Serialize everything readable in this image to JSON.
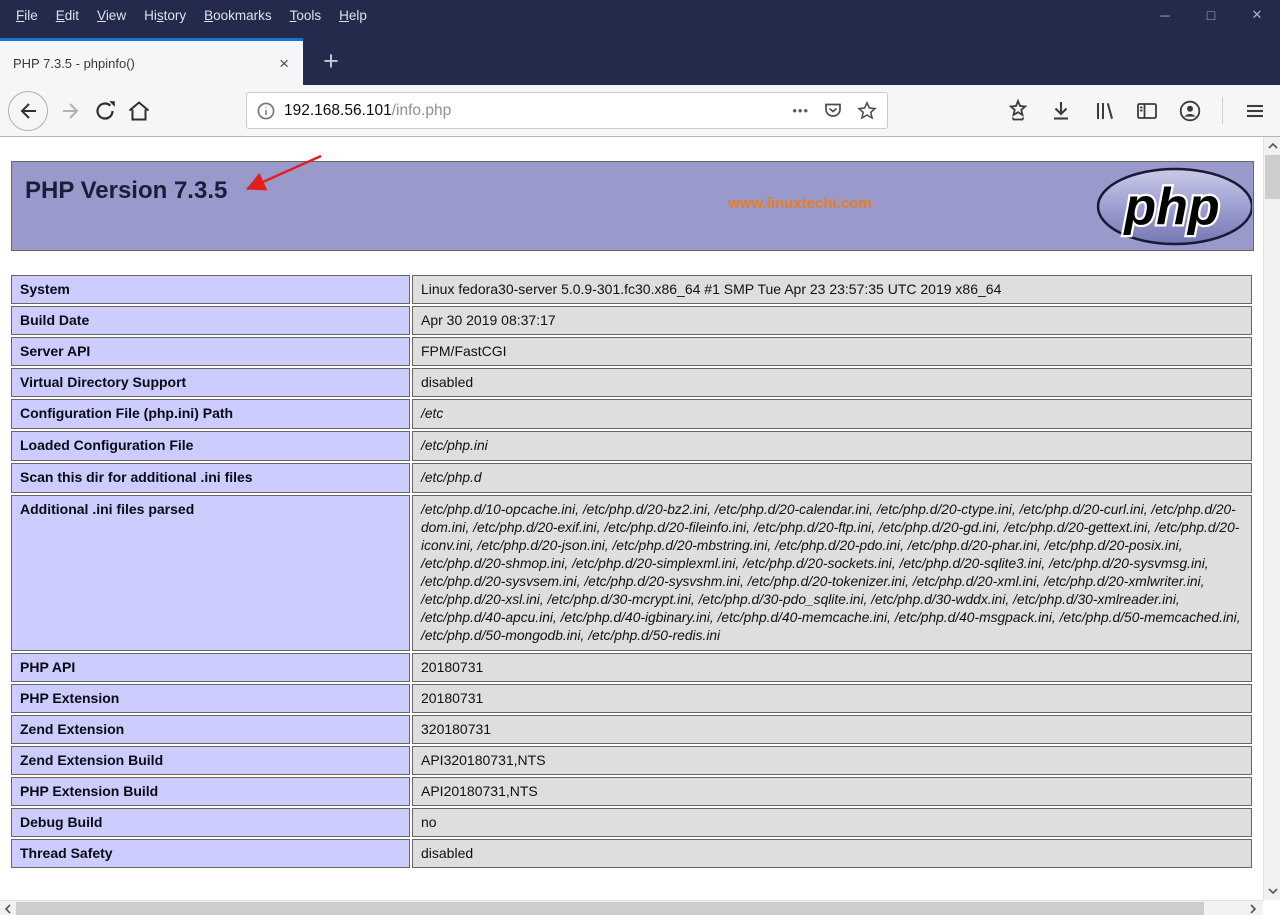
{
  "browser": {
    "menu": [
      {
        "pre": "",
        "accel": "F",
        "rest": "ile"
      },
      {
        "pre": "",
        "accel": "E",
        "rest": "dit"
      },
      {
        "pre": "",
        "accel": "V",
        "rest": "iew"
      },
      {
        "pre": "Hi",
        "accel": "s",
        "rest": "tory"
      },
      {
        "pre": "",
        "accel": "B",
        "rest": "ookmarks"
      },
      {
        "pre": "",
        "accel": "T",
        "rest": "ools"
      },
      {
        "pre": "",
        "accel": "H",
        "rest": "elp"
      }
    ],
    "tab": {
      "title": "PHP 7.3.5 - phpinfo()"
    },
    "url": {
      "host": "192.168.56.101",
      "path": "/info.php"
    }
  },
  "icons": {
    "minimize": "─",
    "maximize": "□",
    "close": "✕",
    "tab_close": "×",
    "new_tab": "+",
    "page_actions": "•••"
  },
  "page": {
    "header": {
      "title": "PHP Version 7.3.5",
      "watermark": "www.linuxtechi.com",
      "logo": "php"
    },
    "info_table": {
      "rows": [
        {
          "label": "System",
          "value": "Linux fedora30-server 5.0.9-301.fc30.x86_64 #1 SMP Tue Apr 23 23:57:35 UTC 2019 x86_64"
        },
        {
          "label": "Build Date",
          "value": "Apr 30 2019 08:37:17"
        },
        {
          "label": "Server API",
          "value": "FPM/FastCGI"
        },
        {
          "label": "Virtual Directory Support",
          "value": "disabled"
        },
        {
          "label": "Configuration File (php.ini) Path",
          "value": "/etc"
        },
        {
          "label": "Loaded Configuration File",
          "value": "/etc/php.ini"
        },
        {
          "label": "Scan this dir for additional .ini files",
          "value": "/etc/php.d"
        },
        {
          "label": "Additional .ini files parsed",
          "value": "/etc/php.d/10-opcache.ini, /etc/php.d/20-bz2.ini, /etc/php.d/20-calendar.ini, /etc/php.d/20-ctype.ini, /etc/php.d/20-curl.ini, /etc/php.d/20-dom.ini, /etc/php.d/20-exif.ini, /etc/php.d/20-fileinfo.ini, /etc/php.d/20-ftp.ini, /etc/php.d/20-gd.ini, /etc/php.d/20-gettext.ini, /etc/php.d/20-iconv.ini, /etc/php.d/20-json.ini, /etc/php.d/20-mbstring.ini, /etc/php.d/20-pdo.ini, /etc/php.d/20-phar.ini, /etc/php.d/20-posix.ini, /etc/php.d/20-shmop.ini, /etc/php.d/20-simplexml.ini, /etc/php.d/20-sockets.ini, /etc/php.d/20-sqlite3.ini, /etc/php.d/20-sysvmsg.ini, /etc/php.d/20-sysvsem.ini, /etc/php.d/20-sysvshm.ini, /etc/php.d/20-tokenizer.ini, /etc/php.d/20-xml.ini, /etc/php.d/20-xmlwriter.ini, /etc/php.d/20-xsl.ini, /etc/php.d/30-mcrypt.ini, /etc/php.d/30-pdo_sqlite.ini, /etc/php.d/30-wddx.ini, /etc/php.d/30-xmlreader.ini, /etc/php.d/40-apcu.ini, /etc/php.d/40-igbinary.ini, /etc/php.d/40-memcache.ini, /etc/php.d/40-msgpack.ini, /etc/php.d/50-memcached.ini, /etc/php.d/50-mongodb.ini, /etc/php.d/50-redis.ini"
        },
        {
          "label": "PHP API",
          "value": "20180731"
        },
        {
          "label": "PHP Extension",
          "value": "20180731"
        },
        {
          "label": "Zend Extension",
          "value": "320180731"
        },
        {
          "label": "Zend Extension Build",
          "value": "API320180731,NTS"
        },
        {
          "label": "PHP Extension Build",
          "value": "API20180731,NTS"
        },
        {
          "label": "Debug Build",
          "value": "no"
        },
        {
          "label": "Thread Safety",
          "value": "disabled"
        }
      ]
    }
  },
  "colors": {
    "chrome_bg": "#232a4b",
    "tab_accent": "#1373d6",
    "toolbar_bg": "#f5f6f7",
    "header_bg": "#9999cc",
    "label_cell_bg": "#ccccff",
    "value_cell_bg": "#dedede",
    "watermark": "#e87d1f",
    "annotation_arrow": "#e02020"
  }
}
